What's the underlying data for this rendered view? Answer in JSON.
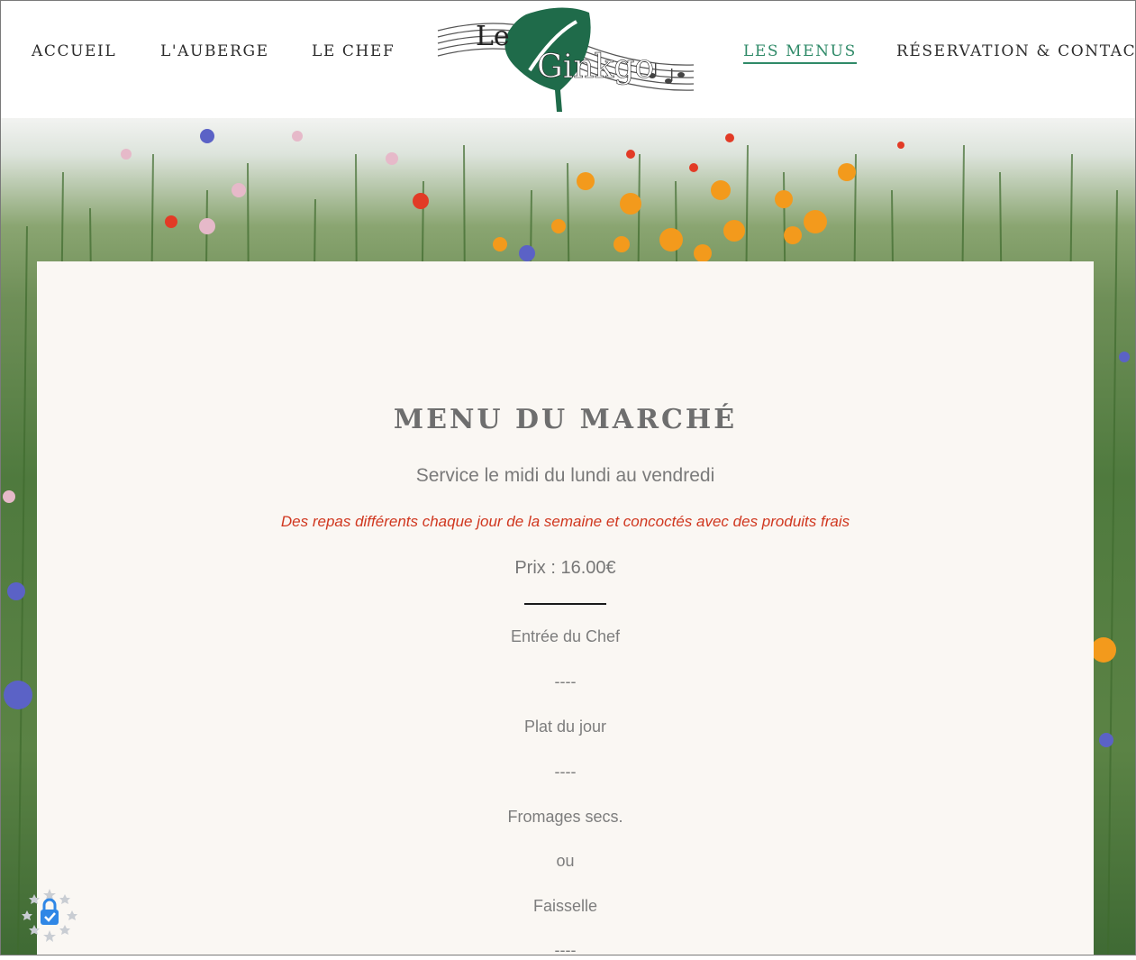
{
  "nav": {
    "left": [
      "ACCUEIL",
      "L'AUBERGE",
      "LE CHEF"
    ],
    "right": [
      "LES MENUS",
      "RÉSERVATION & CONTACT"
    ],
    "active": "LES MENUS"
  },
  "logo": {
    "text_le": "Le",
    "text_ginkgo": "Ginkgo"
  },
  "menu": {
    "title": "MENU DU MARCHÉ",
    "service": "Service le midi du lundi au vendredi",
    "note": "Des repas différents chaque jour de la semaine et concoctés avec des produits frais",
    "price": "Prix : 16.00€",
    "courses": [
      "Entrée du Chef",
      "----",
      "Plat du jour",
      "----",
      "Fromages secs.",
      "ou",
      "Faisselle",
      "----"
    ]
  },
  "colors": {
    "accent": "#2f8a68",
    "note": "#d0371f",
    "panel": "#faf7f3",
    "logo_leaf": "#1f6b4a"
  },
  "icons": {
    "badge": "lock-shield-icon"
  }
}
